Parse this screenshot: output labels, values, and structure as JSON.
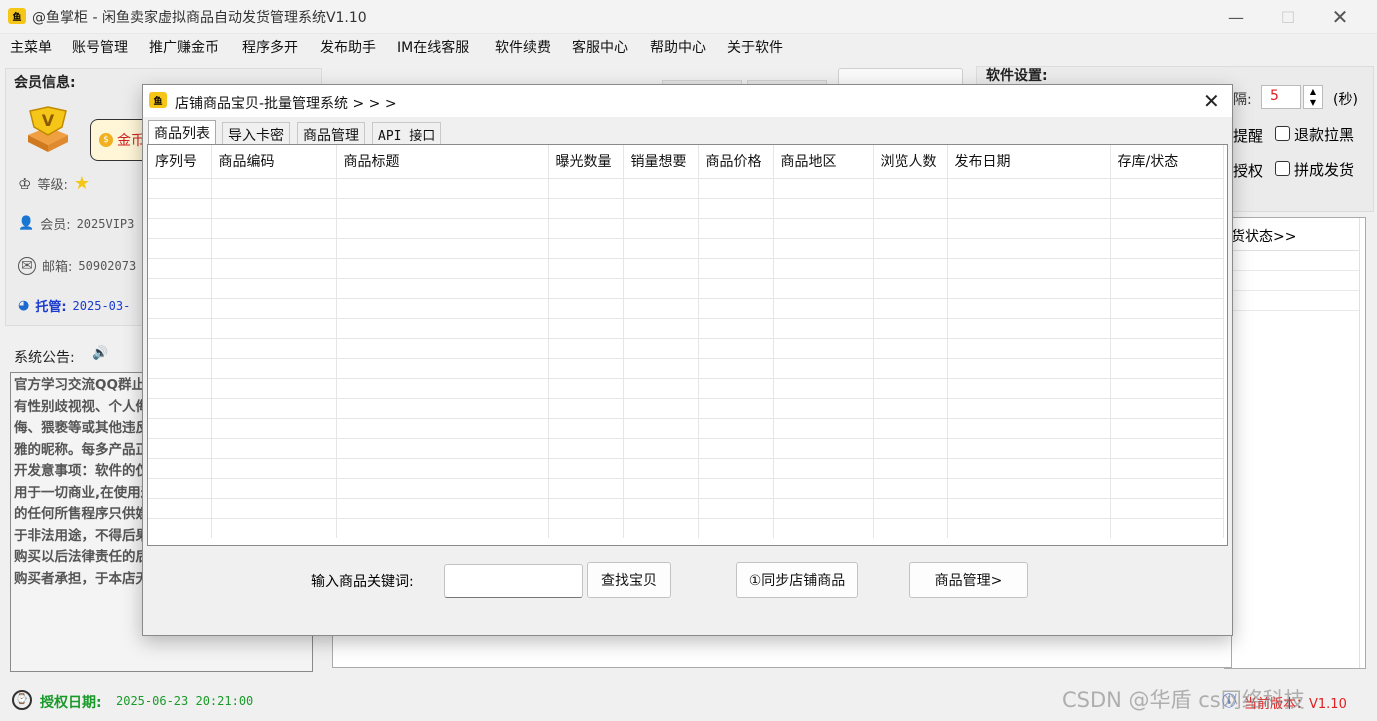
{
  "window": {
    "title": "@鱼掌柜 - 闲鱼卖家虚拟商品自动发货管理系统V1.10",
    "app_icon": "鱼"
  },
  "menu": [
    "主菜单",
    "账号管理",
    "推广赚金币",
    "程序多开",
    "发布助手",
    "IM在线客服",
    "软件续费",
    "客服中心",
    "帮助中心",
    "关于软件"
  ],
  "member": {
    "group_label": "会员信息:",
    "coin_label": "金币",
    "level_label": "等级:",
    "member_label": "会员:",
    "member_value": "2025VIP3",
    "email_label": "邮箱:",
    "email_value": "50902073",
    "hosting_label": "托管:",
    "hosting_value": "2025-03-"
  },
  "notice": {
    "group_label": "系统公告:",
    "text": "官方学习交流QQ群止使用带有性别歧视视、个人侮辱、自侮、猥亵等或其他违反德的不雅的昵称。每多产品正在努力开发意事项：软件的仅限禁止用于一切商业,在使用过程中的任何所售程序只供娱乐模用于非法用途，不得后果自负！购买以后法律责任的后果都由购买者承担，于本店无关!"
  },
  "settings": {
    "group_label": "软件设置:",
    "interval_label": "隔:",
    "interval_value": "5",
    "interval_unit": "(秒)",
    "remind_label": "提醒",
    "refund_label": "退款拉黑",
    "auth_label": "授权",
    "group_ship_label": "拼成发货",
    "ship_status_label": "货状态>>"
  },
  "footer": {
    "auth_date_label": "授权日期:",
    "auth_date_value": "2025-06-23 20:21:00",
    "version_label": "当前版本：V1.10",
    "watermark": "CSDN @华盾 cs网络科技"
  },
  "dialog": {
    "title": "店铺商品宝贝-批量管理系统 > > >",
    "tabs": [
      "商品列表",
      "导入卡密",
      "商品管理",
      "API 接口"
    ],
    "columns": [
      "序列号",
      "商品编码",
      "商品标题",
      "曝光数量",
      "销量想要",
      "商品价格",
      "商品地区",
      "浏览人数",
      "发布日期",
      "存库/状态"
    ],
    "keyword_label": "输入商品关键词:",
    "keyword_value": "",
    "search_button": "查找宝贝",
    "sync_button": "①同步店铺商品",
    "manage_button": "商品管理>"
  }
}
